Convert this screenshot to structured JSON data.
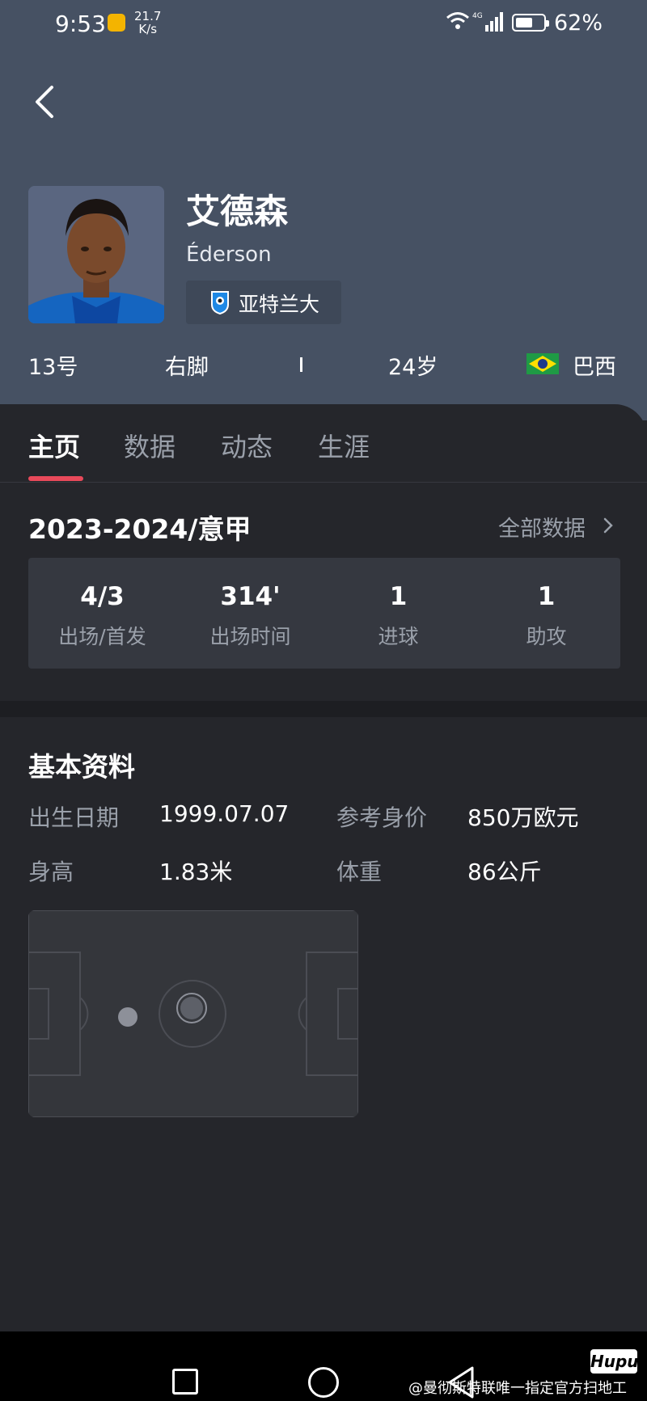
{
  "status_bar": {
    "time": "9:53",
    "net_speed_value": "21.7",
    "net_speed_unit": "K/s",
    "cell_type": "4G",
    "battery_text": "62%",
    "battery_level": 0.62
  },
  "player": {
    "name_cn": "艾德森",
    "name_en": "Éderson",
    "club": "亚特兰大",
    "number": "13号",
    "foot": "右脚",
    "age": "24岁",
    "nationality": "巴西"
  },
  "tabs": [
    {
      "label": "主页",
      "active": true
    },
    {
      "label": "数据",
      "active": false
    },
    {
      "label": "动态",
      "active": false
    },
    {
      "label": "生涯",
      "active": false
    }
  ],
  "season": {
    "title": "2023-2024/意甲",
    "all_data_label": "全部数据",
    "stats": [
      {
        "value": "4/3",
        "label": "出场/首发"
      },
      {
        "value": "314'",
        "label": "出场时间"
      },
      {
        "value": "1",
        "label": "进球"
      },
      {
        "value": "1",
        "label": "助攻"
      }
    ]
  },
  "basic_info": {
    "title": "基本资料",
    "birth_label": "出生日期",
    "birth_value": "1999.07.07",
    "market_label": "参考身价",
    "market_value": "850万欧元",
    "height_label": "身高",
    "height_value": "1.83米",
    "weight_label": "体重",
    "weight_value": "86公斤"
  },
  "nav_bar": {
    "brand": "Hupu",
    "watermark": "@曼彻斯特联唯一指定官方扫地工"
  },
  "colors": {
    "hero_bg": "#465163",
    "panel_bg": "#25262b",
    "accent_red": "#e8495a",
    "muted_text": "#9aa0aa"
  }
}
